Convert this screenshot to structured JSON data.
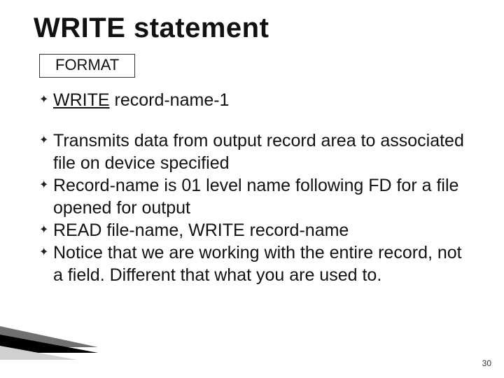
{
  "title": "WRITE statement",
  "format_label": "FORMAT",
  "syntax": {
    "keyword": "WRITE",
    "rest": " record-name-1"
  },
  "bullets": [
    "Transmits data from output record area to associated file on device specified",
    "Record-name is 01 level name following FD for a file opened for output",
    "READ file-name, WRITE record-name",
    "Notice that we are working with the entire record, not a field.  Different that what you are used to."
  ],
  "page_number": "30"
}
